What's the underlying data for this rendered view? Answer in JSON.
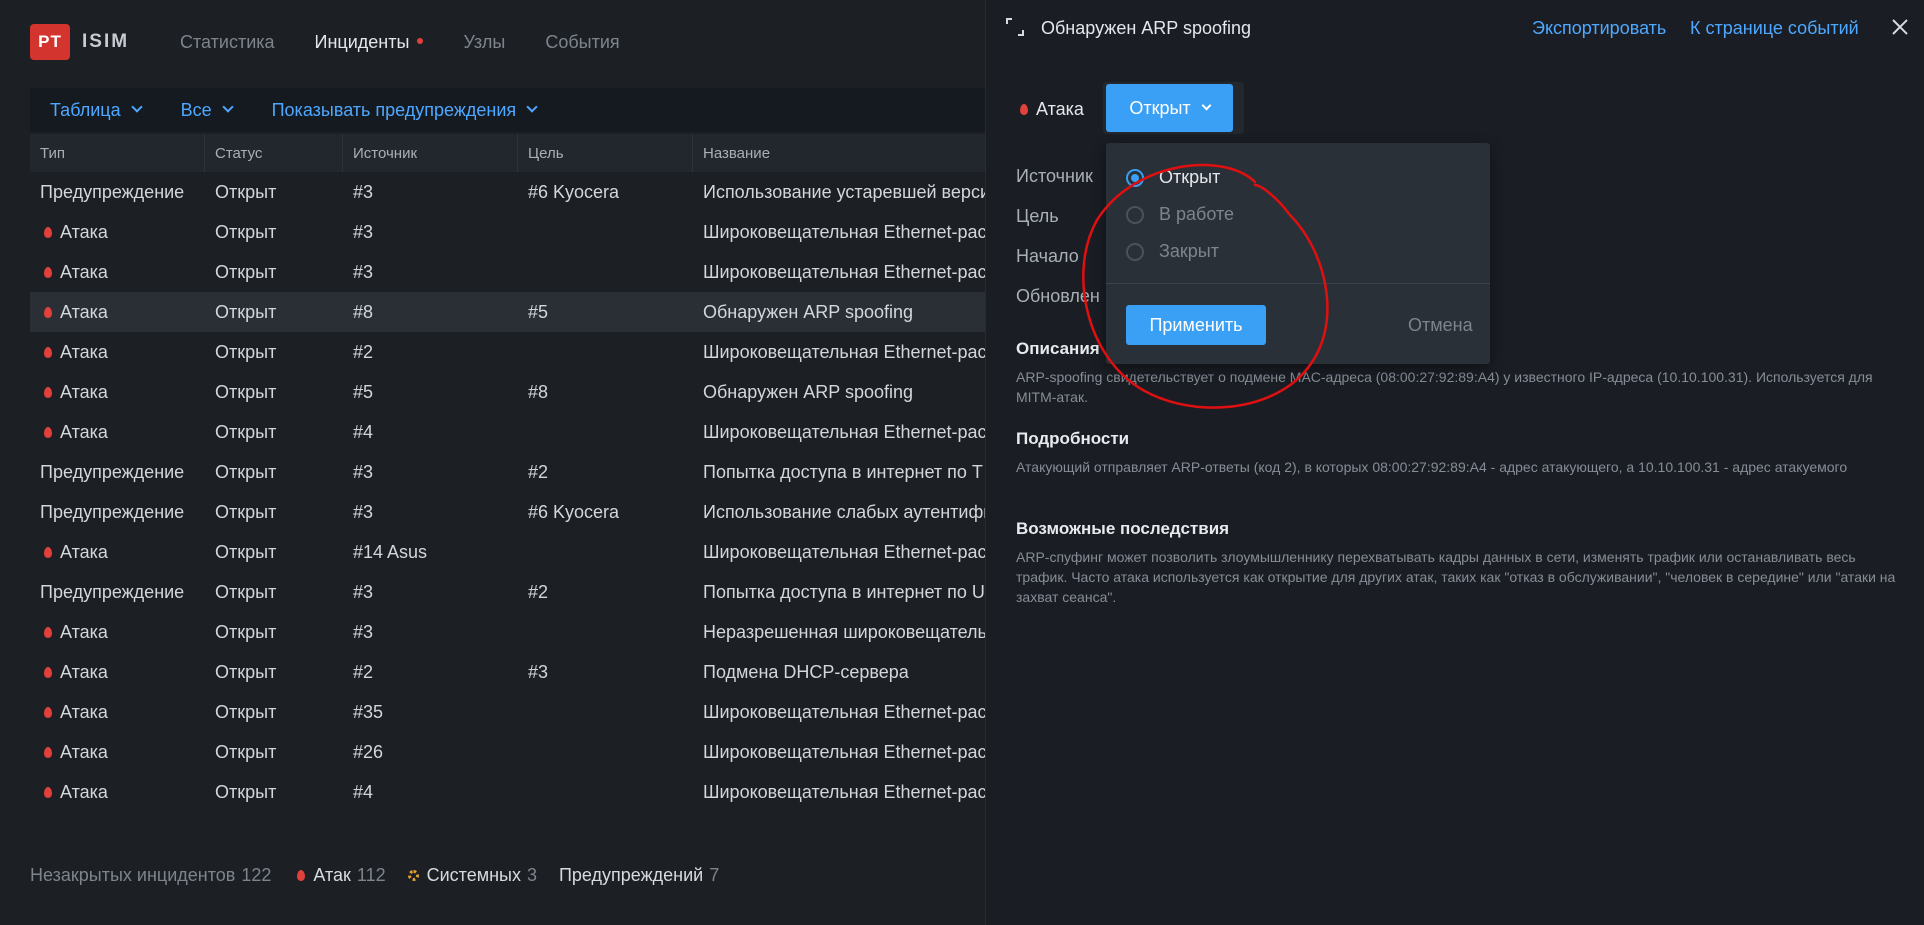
{
  "app": {
    "logo_mark": "PT",
    "logo_text": "ISIM"
  },
  "nav": {
    "items": [
      {
        "label": "Статистика"
      },
      {
        "label": "Инциденты"
      },
      {
        "label": "Узлы"
      },
      {
        "label": "События"
      }
    ]
  },
  "filters": {
    "view": "Таблица",
    "scope": "Все",
    "warnings": "Показывать предупреждения"
  },
  "table": {
    "headers": [
      "Тип",
      "Статус",
      "Источник",
      "Цель",
      "Название"
    ],
    "rows": [
      {
        "type": "Предупреждение",
        "status": "Открыт",
        "source": "#3",
        "target": "#6 Kyocera",
        "name": "Использование устаревшей верси"
      },
      {
        "type": "Атака",
        "status": "Открыт",
        "source": "#3",
        "target": "",
        "name": "Широковещательная Ethernet-рас"
      },
      {
        "type": "Атака",
        "status": "Открыт",
        "source": "#3",
        "target": "",
        "name": "Широковещательная Ethernet-рас"
      },
      {
        "type": "Атака",
        "status": "Открыт",
        "source": "#8",
        "target": "#5",
        "name": "Обнаружен ARP spoofing"
      },
      {
        "type": "Атака",
        "status": "Открыт",
        "source": "#2",
        "target": "",
        "name": "Широковещательная Ethernet-рас"
      },
      {
        "type": "Атака",
        "status": "Открыт",
        "source": "#5",
        "target": "#8",
        "name": "Обнаружен ARP spoofing"
      },
      {
        "type": "Атака",
        "status": "Открыт",
        "source": "#4",
        "target": "",
        "name": "Широковещательная Ethernet-рас"
      },
      {
        "type": "Предупреждение",
        "status": "Открыт",
        "source": "#3",
        "target": "#2",
        "name": "Попытка доступа в интернет по Т"
      },
      {
        "type": "Предупреждение",
        "status": "Открыт",
        "source": "#3",
        "target": "#6 Kyocera",
        "name": "Использование слабых аутентифи"
      },
      {
        "type": "Атака",
        "status": "Открыт",
        "source": "#14 Asus",
        "target": "",
        "name": "Широковещательная Ethernet-рас"
      },
      {
        "type": "Предупреждение",
        "status": "Открыт",
        "source": "#3",
        "target": "#2",
        "name": "Попытка доступа в интернет по U"
      },
      {
        "type": "Атака",
        "status": "Открыт",
        "source": "#3",
        "target": "",
        "name": "Неразрешенная широковещательн"
      },
      {
        "type": "Атака",
        "status": "Открыт",
        "source": "#2",
        "target": "#3",
        "name": "Подмена DHCP-сервера"
      },
      {
        "type": "Атака",
        "status": "Открыт",
        "source": "#35",
        "target": "",
        "name": "Широковещательная Ethernet-рас"
      },
      {
        "type": "Атака",
        "status": "Открыт",
        "source": "#26",
        "target": "",
        "name": "Широковещательная Ethernet-рас"
      },
      {
        "type": "Атака",
        "status": "Открыт",
        "source": "#4",
        "target": "",
        "name": "Широковещательная Ethernet-рас"
      }
    ]
  },
  "footer": {
    "open_label": "Незакрытых инцидентов",
    "open_count": "122",
    "attacks_label": "Атак",
    "attacks_count": "112",
    "system_label": "Системных",
    "system_count": "3",
    "warnings_label": "Предупреждений",
    "warnings_count": "7"
  },
  "panel": {
    "title": "Обнаружен ARP spoofing",
    "export_link": "Экспортировать",
    "events_link": "К странице событий",
    "type_label": "Атака",
    "status_value": "Открыт",
    "info_labels": [
      "Источник",
      "Цель",
      "Начало",
      "Обновлен"
    ],
    "dropdown": {
      "options": [
        {
          "label": "Открыт",
          "selected": true
        },
        {
          "label": "В работе",
          "selected": false
        },
        {
          "label": "Закрыт",
          "selected": false
        }
      ],
      "apply": "Применить",
      "cancel": "Отмена"
    },
    "description_title": "Описания",
    "description_text": "ARP-spoofing свидетельствует о подмене MAC-адреса (08:00:27:92:89:A4) у известного IP-адреса (10.10.100.31). Используется для MITM-атак.",
    "details_title": "Подробности",
    "details_text": "Атакующий отправляет ARP-ответы (код 2), в которых 08:00:27:92:89:A4 - адрес атакующего, а 10.10.100.31 - адрес атакуемого",
    "consequences_title": "Возможные последствия",
    "consequences_text": "ARP-спуфинг может позволить злоумышленнику перехватывать кадры данных в сети, изменять трафик или останавливать весь трафик. Часто атака используется как открытие для других атак, таких как \"отказ в обслуживании\", \"человек в середине\" или \"атаки на захват сеанса\"."
  },
  "colors": {
    "accent": "#3aa0f5",
    "link": "#4ea8ff",
    "attack": "#e0413a",
    "system": "#e0a030",
    "annotation": "#e01010"
  }
}
